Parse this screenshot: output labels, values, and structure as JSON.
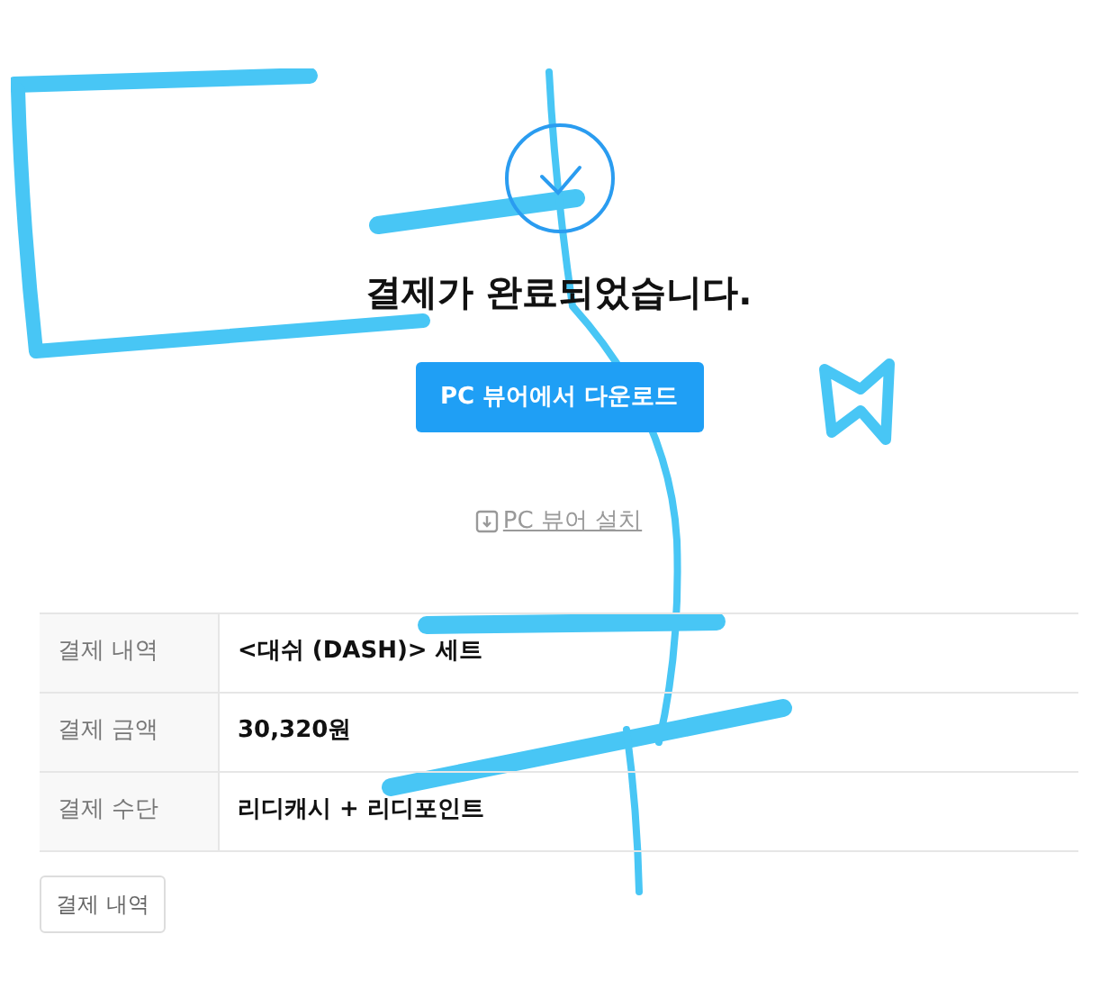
{
  "title": "결제가 완료되었습니다.",
  "primary_button": "PC 뷰어에서 다운로드",
  "install_link": "PC 뷰어 설치",
  "details": [
    {
      "label": "결제 내역",
      "value": "<대쉬 (DASH)> 세트"
    },
    {
      "label": "결제 금액",
      "value": "30,320원"
    },
    {
      "label": "결제 수단",
      "value": "리디캐시 + 리디포인트"
    }
  ],
  "secondary_button": "결제 내역"
}
